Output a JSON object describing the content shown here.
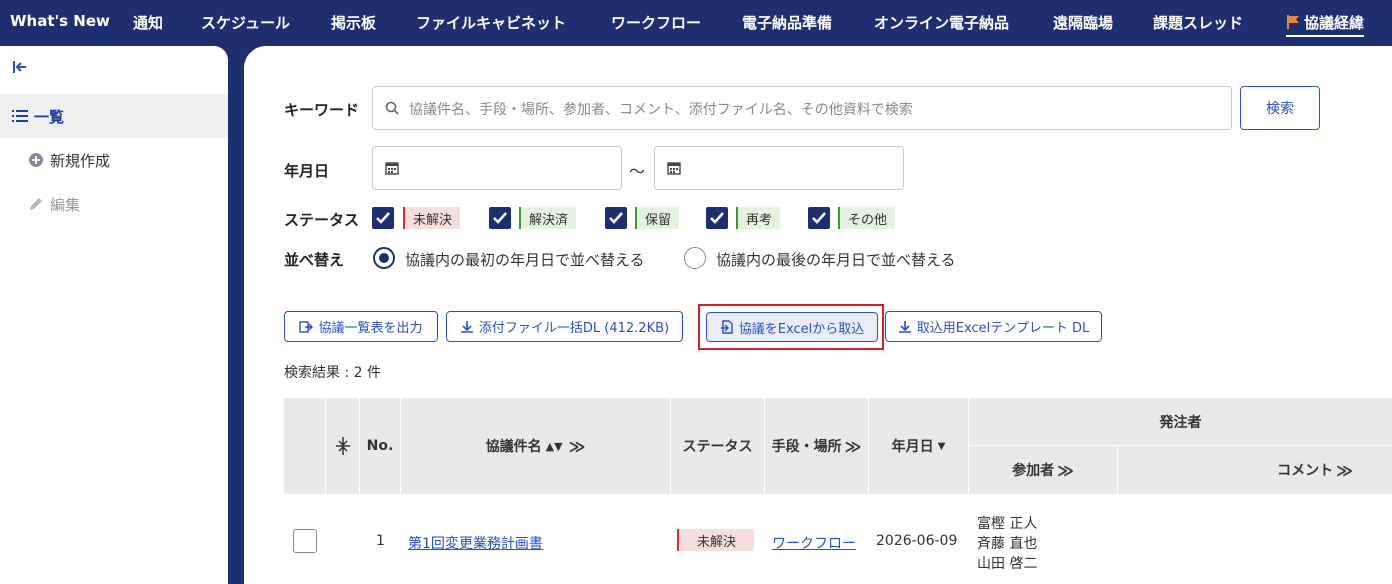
{
  "nav": {
    "items": [
      "What's New",
      "通知",
      "スケジュール",
      "掲示板",
      "ファイルキャビネット",
      "ワークフロー",
      "電子納品準備",
      "オンライン電子納品",
      "遠隔臨場",
      "課題スレッド",
      "協議経緯"
    ],
    "active": "協議経緯"
  },
  "sidebar": {
    "collapse_icon": "collapse-left-icon",
    "list_label": "一覧",
    "new_label": "新規作成",
    "edit_label": "編集"
  },
  "search": {
    "keyword_label": "キーワード",
    "keyword_placeholder": "協議件名、手段・場所、参加者、コメント、添付ファイル名、その他資料で検索",
    "search_button": "検索",
    "date_label": "年月日",
    "date_separator": "～",
    "status_label": "ステータス",
    "statuses": [
      {
        "label": "未解決",
        "color": "red",
        "checked": true
      },
      {
        "label": "解決済",
        "color": "green",
        "checked": true
      },
      {
        "label": "保留",
        "color": "green",
        "checked": true
      },
      {
        "label": "再考",
        "color": "green",
        "checked": true
      },
      {
        "label": "その他",
        "color": "green",
        "checked": true
      }
    ],
    "sort_label": "並べ替え",
    "sort_options": [
      "協議内の最初の年月日で並べ替える",
      "協議内の最後の年月日で並べ替える"
    ],
    "sort_selected": 0
  },
  "actions": {
    "export_list": "協議一覧表を出力",
    "download_attachments": "添付ファイル一括DL (412.2KB)",
    "import_excel": "協議をExcelから取込",
    "template_dl": "取込用Excelテンプレート DL"
  },
  "results": {
    "label": "検索結果 : 2 件"
  },
  "table": {
    "headers": {
      "no": "No.",
      "title": "協議件名",
      "status": "ステータス",
      "method": "手段・場所",
      "date": "年月日",
      "client_group": "発注者",
      "participants": "参加者",
      "comment": "コメント"
    },
    "rows": [
      {
        "no": "1",
        "title": "第1回変更業務計画書",
        "status": "未解決",
        "method": "ワークフロー",
        "date": "2026-06-09",
        "participants": [
          "富樫 正人",
          "斉藤 直也",
          "山田 啓二"
        ]
      }
    ]
  },
  "colors": {
    "navy": "#1d2f6f",
    "accent": "#2b4fc7",
    "highlight": "#d42020"
  }
}
